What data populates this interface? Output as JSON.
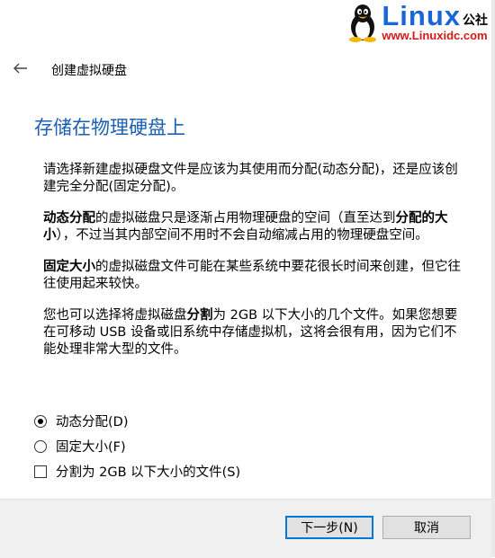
{
  "watermark": {
    "brand": "Linux",
    "brand_cn": "公社",
    "url": "www.Linuxidc.com"
  },
  "header": {
    "title": "创建虚拟硬盘"
  },
  "page": {
    "title": "存储在物理硬盘上",
    "para1": "请选择新建虚拟硬盘文件是应该为其使用而分配(动态分配)，还是应该创建完全分配(固定分配)。",
    "para2": {
      "b1": "动态分配",
      "t1": "的虚拟磁盘只是逐渐占用物理硬盘的空间（直至达到",
      "b2": "分配的大小",
      "t2": "），不过当其内部空间不用时不会自动缩减占用的物理硬盘空间。"
    },
    "para3": {
      "b1": "固定大小",
      "t1": "的虚拟磁盘文件可能在某些系统中要花很长时间来创建，但它往往使用起来较快。"
    },
    "para4": {
      "t1": "您也可以选择将虚拟磁盘",
      "b1": "分割",
      "t2": "为 2GB 以下大小的几个文件。如果您想要在可移动 USB 设备或旧系统中存储虚拟机，这将会很有用，因为它们不能处理非常大型的文件。"
    }
  },
  "options": {
    "dynamic": "动态分配(D)",
    "fixed": "固定大小(F)",
    "split": "分割为 2GB 以下大小的文件(S)",
    "selected": "dynamic",
    "split_checked": false
  },
  "buttons": {
    "next": "下一步(N)",
    "cancel": "取消"
  },
  "colors": {
    "title_blue": "#1a5fb4",
    "brand_blue": "#1a66d9",
    "brand_red": "#d81818",
    "focus_blue": "#0078d7"
  }
}
